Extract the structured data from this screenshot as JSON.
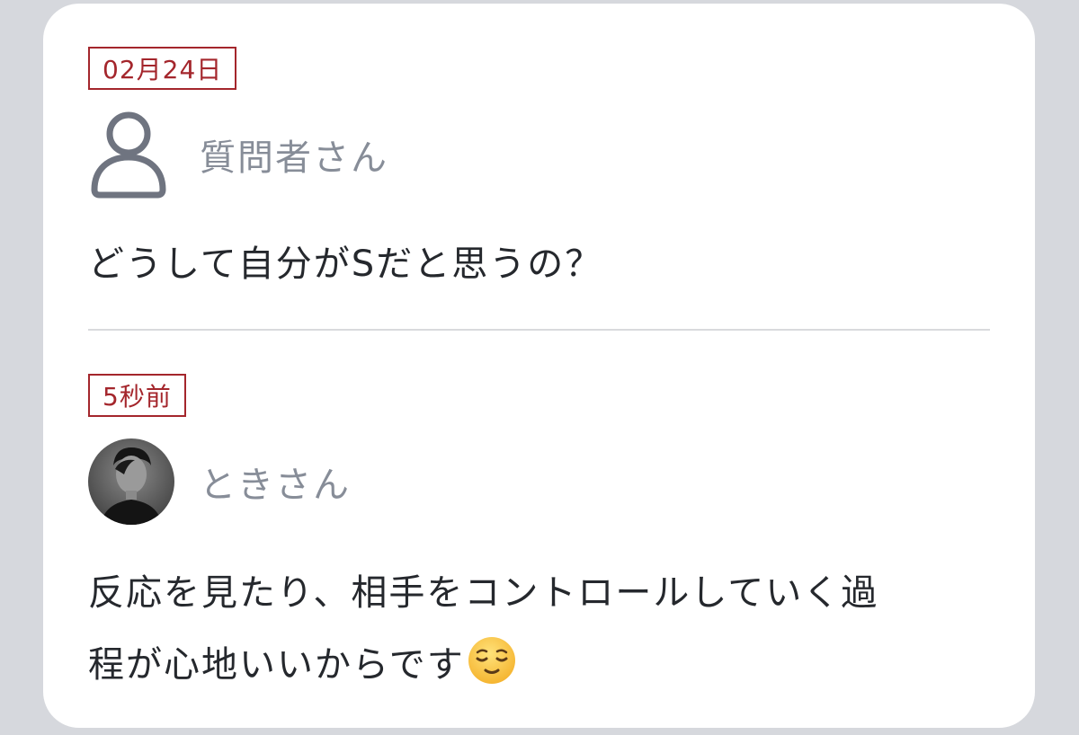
{
  "question": {
    "date": "02月24日",
    "user_name": "質問者さん",
    "text": "どうして自分がSだと思うの？"
  },
  "answer": {
    "date": "5秒前",
    "user_name": "ときさん",
    "text_line1": "反応を見たり、相手をコントロールしていく過",
    "text_line2": "程が心地いいからです"
  },
  "colors": {
    "accent": "#a4262c",
    "name_gray": "#878d98",
    "text": "#25282d",
    "background": "#d6d8dd"
  },
  "icons": {
    "question_user": "person-outline-icon",
    "emoji": "relieved-face-emoji"
  }
}
